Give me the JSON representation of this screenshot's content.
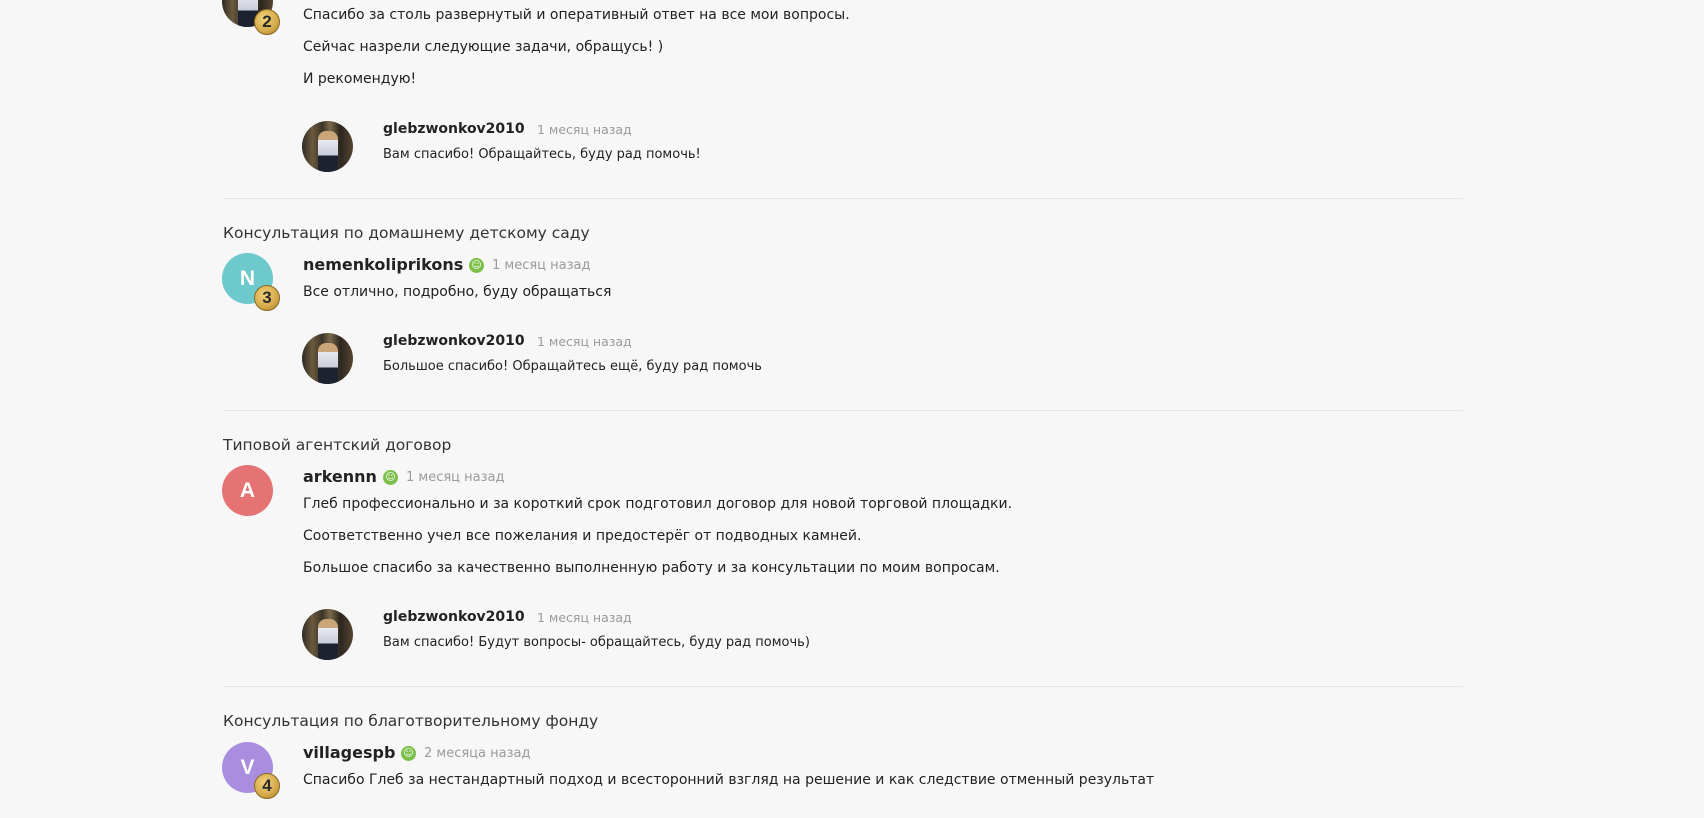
{
  "reviews": [
    {
      "topic": "",
      "avatar_letter": "",
      "badge": "2",
      "lines": [
        "Спасибо за столь развернутый и оперативный ответ на все мои вопросы.",
        "Сейчас назрели следующие задачи, обращусь! )",
        "И рекомендую!"
      ],
      "reply": {
        "user": "glebzwonkov2010",
        "time": "1 месяц назад",
        "text": "Вам спасибо! Обращайтесь, буду рад помочь!"
      }
    },
    {
      "topic": "Консультация по домашнему детскому саду",
      "avatar_letter": "N",
      "avatar_color": "#6ec9cd",
      "badge": "3",
      "user": "nemenkoliprikons",
      "time": "1 месяц назад",
      "lines": [
        "Все отлично, подробно, буду обращаться"
      ],
      "reply": {
        "user": "glebzwonkov2010",
        "time": "1 месяц назад",
        "text": "Большое спасибо! Обращайтесь ещё, буду рад помочь"
      }
    },
    {
      "topic": "Типовой агентский договор",
      "avatar_letter": "A",
      "avatar_color": "#e57373",
      "user": "arkennn",
      "time": "1 месяц назад",
      "lines": [
        "Глеб профессионально и за короткий срок подготовил договор для новой торговой площадки.",
        "Соответственно учел все пожелания и предостерёг от подводных камней.",
        "Большое спасибо за качественно выполненную работу и за консультации по моим вопросам."
      ],
      "reply": {
        "user": "glebzwonkov2010",
        "time": "1 месяц назад",
        "text": "Вам спасибо! Будут вопросы- обращайтесь, буду рад помочь)"
      }
    },
    {
      "topic": "Консультация по благотворительному фонду",
      "avatar_letter": "V",
      "avatar_color": "#a98ee0",
      "badge": "4",
      "user": "villagespb",
      "time": "2 месяца назад",
      "lines": [
        "Спасибо Глеб за нестандартный подход и всесторонний взгляд на решение и как следствие отменный результат"
      ]
    }
  ]
}
